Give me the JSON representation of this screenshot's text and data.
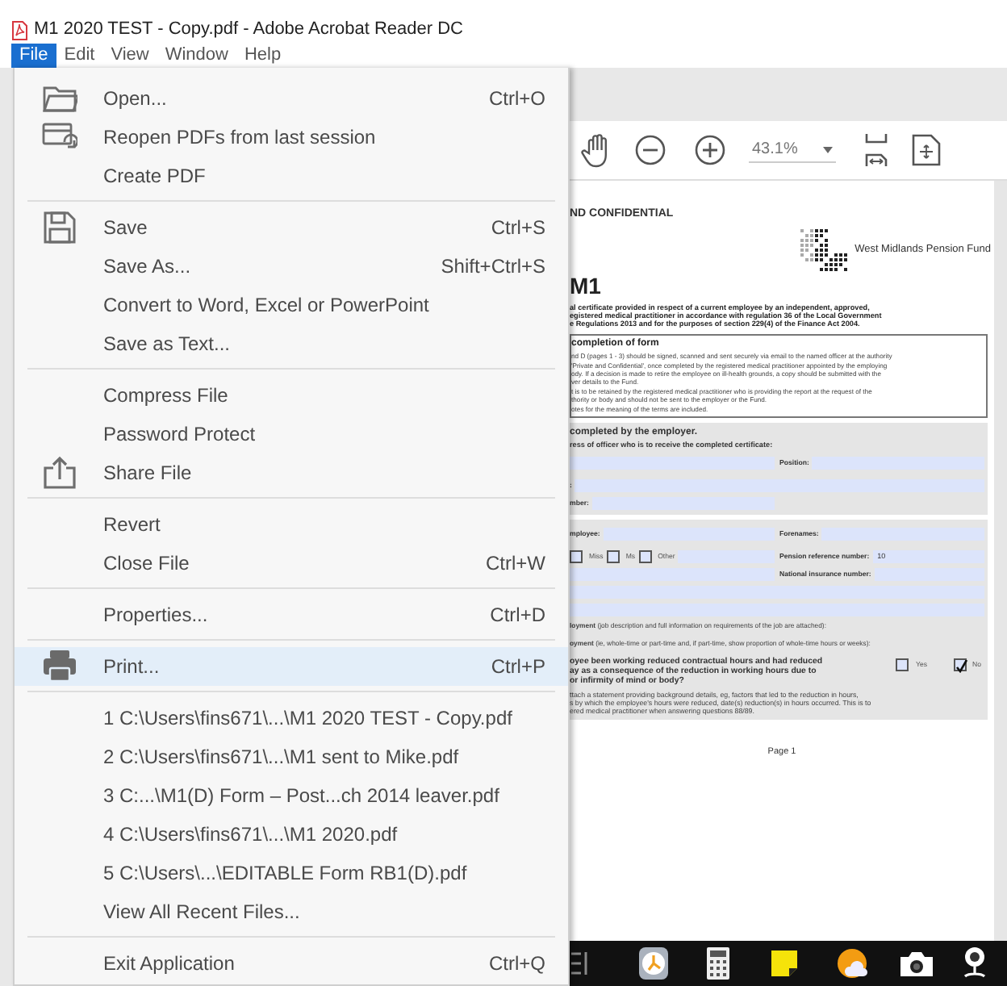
{
  "window": {
    "title": "M1 2020 TEST - Copy.pdf - Adobe Acrobat Reader DC"
  },
  "menubar": [
    {
      "label": "File",
      "selected": true
    },
    {
      "label": "Edit",
      "selected": false
    },
    {
      "label": "View",
      "selected": false
    },
    {
      "label": "Window",
      "selected": false
    },
    {
      "label": "Help",
      "selected": false
    }
  ],
  "file_menu": {
    "groups": [
      [
        {
          "label": "Open...",
          "shortcut": "Ctrl+O",
          "kind": "folder",
          "selected": false
        },
        {
          "label": "Reopen PDFs from last session",
          "kind": "reopen",
          "selected": false
        },
        {
          "label": "Create PDF",
          "selected": false
        }
      ],
      [
        {
          "label": "Save",
          "shortcut": "Ctrl+S",
          "kind": "save",
          "selected": false
        },
        {
          "label": "Save As...",
          "shortcut": "Shift+Ctrl+S",
          "selected": false
        },
        {
          "label": "Convert to Word, Excel or PowerPoint",
          "selected": false
        },
        {
          "label": "Save as Text...",
          "selected": false
        }
      ],
      [
        {
          "label": "Compress File",
          "selected": false
        },
        {
          "label": "Password Protect",
          "selected": false
        },
        {
          "label": "Share File",
          "kind": "share",
          "selected": false
        }
      ],
      [
        {
          "label": "Revert",
          "selected": false
        },
        {
          "label": "Close File",
          "shortcut": "Ctrl+W",
          "selected": false
        }
      ],
      [
        {
          "label": "Properties...",
          "shortcut": "Ctrl+D",
          "selected": false
        }
      ],
      [
        {
          "label": "Print...",
          "shortcut": "Ctrl+P",
          "kind": "print",
          "selected": true
        }
      ],
      [
        {
          "label": "1 C:\\Users\\fins671\\...\\M1 2020 TEST - Copy.pdf",
          "selected": false
        },
        {
          "label": "2 C:\\Users\\fins671\\...\\M1 sent to Mike.pdf",
          "selected": false
        },
        {
          "label": "3 C:...\\M1(D) Form – Post...ch 2014 leaver.pdf",
          "selected": false
        },
        {
          "label": "4 C:\\Users\\fins671\\...\\M1 2020.pdf",
          "selected": false
        },
        {
          "label": "5 C:\\Users\\...\\EDITABLE Form RB1(D).pdf",
          "selected": false
        },
        {
          "label": "View All Recent Files...",
          "selected": false
        }
      ],
      [
        {
          "label": "Exit Application",
          "shortcut": "Ctrl+Q",
          "selected": false
        }
      ]
    ]
  },
  "toolbar": {
    "zoom": "43.1%"
  },
  "document": {
    "blocks": [
      {
        "kind": "heading",
        "text": "ND CONFIDENTIAL"
      },
      {
        "kind": "logo",
        "text": "West Midlands Pension Fund"
      },
      {
        "kind": "title",
        "text": "M1"
      },
      {
        "kind": "intro",
        "lines": [
          "al certificate provided in respect of a current employee by an independent, approved,",
          "egistered medical practitioner in accordance with regulation 36 of the Local Government",
          "e Regulations 2013 and for the purposes of section 229(4) of the Finance Act 2004."
        ]
      },
      {
        "kind": "notes",
        "title": "completion of form",
        "lines": [
          "nd D (pages 1 - 3) should be signed, scanned and sent securely via email to the named officer at the authority",
          "'Private and Confidential', once completed by the registered medical practitioner appointed by the employing",
          "ody. If a decision is made to retire the employee on ill-health grounds, a copy should be submitted with the",
          "ver details to the Fund.",
          "t is to be retained by the registered medical practitioner who is providing the report at the request of the",
          "thority or body and should not be sent to the employer or the Fund.",
          "otes for the meaning of the terms are included."
        ]
      },
      {
        "kind": "section",
        "title": "completed by the employer.",
        "instruction": "ress of officer who is to receive the completed certificate:",
        "rows": [
          [
            {
              "kind": "field"
            },
            {
              "kind": "field",
              "label": "Position:"
            }
          ],
          [
            {
              "kind": "area"
            }
          ],
          [
            {
              "kind": "field",
              "label": ":"
            }
          ],
          [
            {
              "kind": "field",
              "label": "mber:"
            },
            {
              "kind": "blank"
            }
          ]
        ]
      },
      {
        "kind": "section",
        "rows": [
          [
            {
              "kind": "field",
              "label": "mployee:"
            },
            {
              "kind": "field",
              "label": "Forenames:"
            }
          ],
          [
            {
              "kind": "area"
            }
          ],
          [
            {
              "kind": "choices",
              "options": [
                {
                  "label": "Miss",
                  "checked": false
                },
                {
                  "label": "Ms",
                  "checked": false
                },
                {
                  "label": "Other",
                  "checked": false
                }
              ]
            },
            {
              "kind": "field",
              "label": "Pension reference number:",
              "value": "10"
            }
          ],
          [
            {
              "kind": "field"
            },
            {
              "kind": "field",
              "label": "National insurance number:"
            }
          ],
          [
            {
              "kind": "field"
            }
          ],
          [
            {
              "kind": "field"
            }
          ],
          [
            {
              "kind": "area",
              "label": "**loyment** (job description and full information on requirements of the job are attached):"
            }
          ],
          [
            {
              "kind": "area",
              "label": "**oyment** (ie, whole-time or part-time and, if part-time, show proportion of whole-time hours or weeks):"
            }
          ]
        ],
        "question": {
          "lines": [
            "oyee been working reduced contractual hours and had reduced",
            "ay as a consequence of the reduction in working hours due to",
            "or infirmity of mind or body?"
          ],
          "options": [
            {
              "label": "Yes",
              "checked": false
            },
            {
              "label": "No",
              "checked": true
            }
          ]
        },
        "note": [
          "ttach a statement providing background details, eg, factors that led to the reduction in hours,",
          "s by which the employee's hours were reduced, date(s) reduction(s) in hours occurred. This is to",
          "ered medical practitioner when answering questions 88/89."
        ]
      },
      {
        "kind": "footer",
        "text": "Page 1"
      }
    ]
  }
}
